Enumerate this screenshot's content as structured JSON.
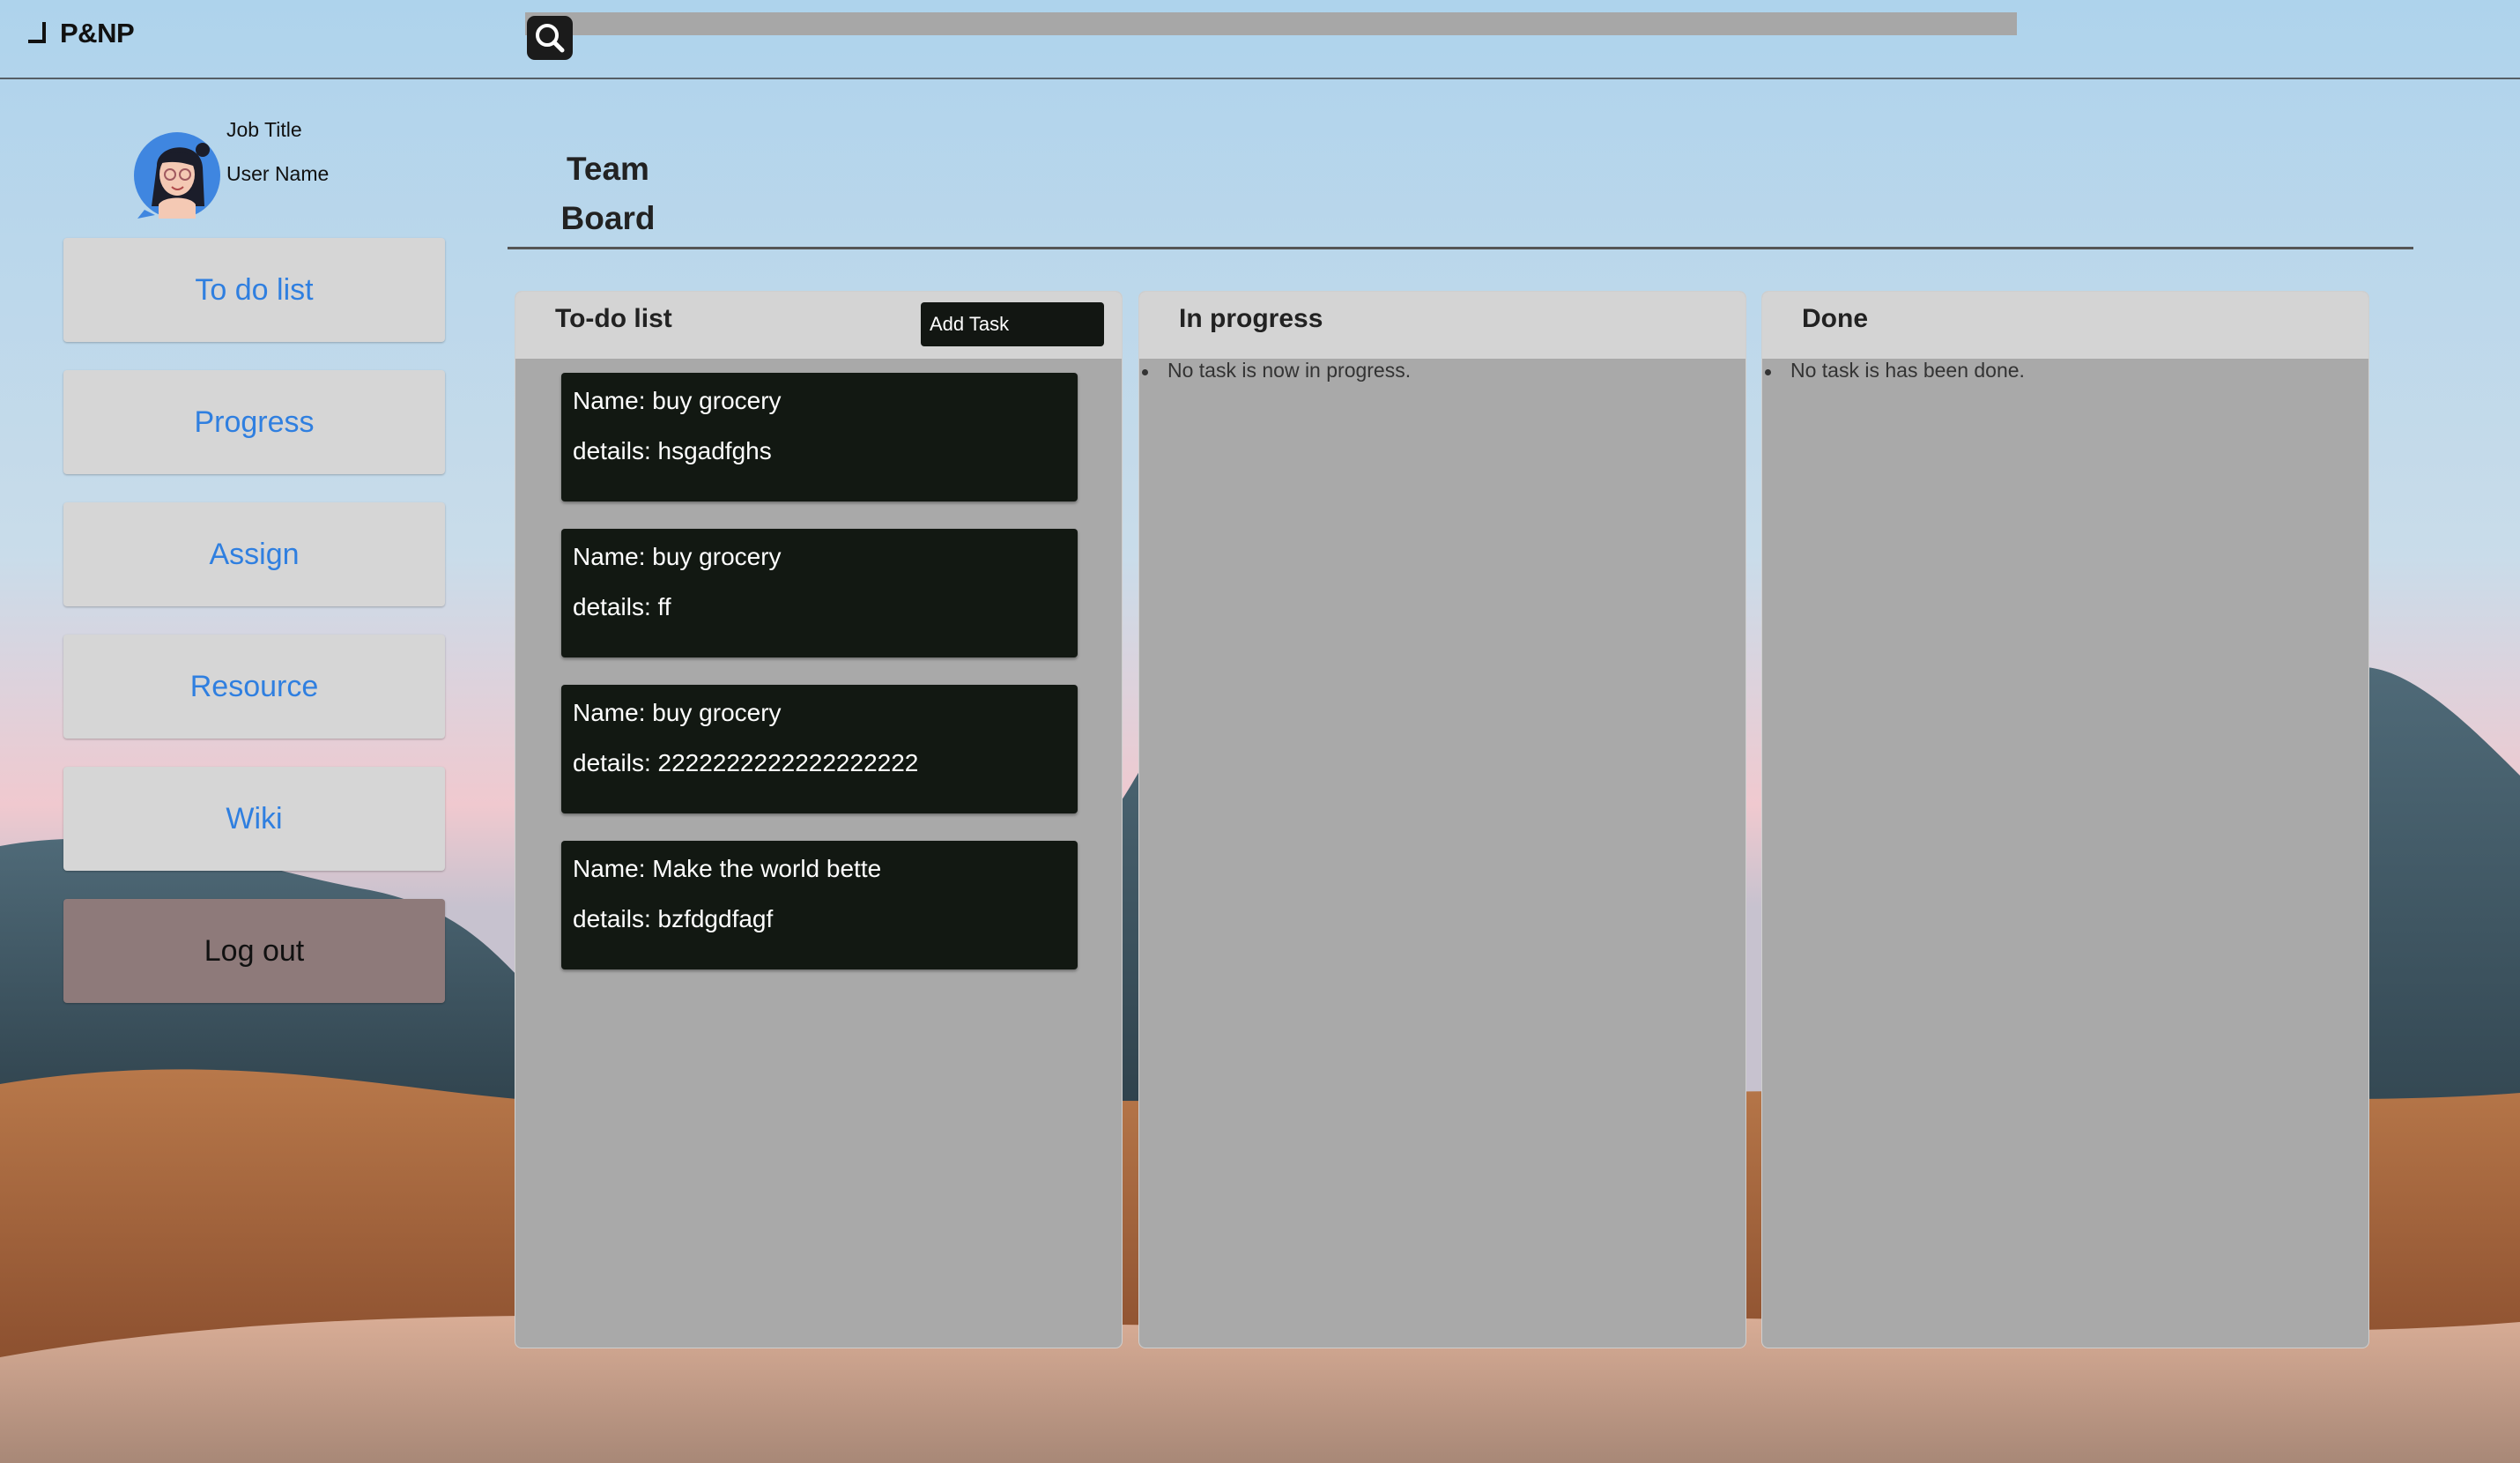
{
  "app": {
    "logo_text": "P&NP"
  },
  "search": {
    "button_icon": "search-icon"
  },
  "profile": {
    "job_title": "Job Title",
    "user_name": "User Name"
  },
  "sidebar": {
    "items": [
      {
        "label": "To do list"
      },
      {
        "label": "Progress"
      },
      {
        "label": "Assign"
      },
      {
        "label": "Resource"
      },
      {
        "label": "Wiki"
      }
    ],
    "logout_label": "Log out"
  },
  "board": {
    "title_line1": "Team",
    "title_line2": "Board",
    "columns": [
      {
        "title": "To-do list",
        "add_task_label": "Add Task",
        "tasks": [
          {
            "name": "Name: buy grocery",
            "details": "details: hsgadfghs"
          },
          {
            "name": "Name: buy grocery",
            "details": "details: ff"
          },
          {
            "name": "Name: buy grocery",
            "details": "details: 2222222222222222222"
          },
          {
            "name": "Name: Make the world bette",
            "details": "details: bzfdgdfagf"
          }
        ]
      },
      {
        "title": "In progress",
        "empty_message": "No task is now in progress."
      },
      {
        "title": "Done",
        "empty_message": "No task is has been done."
      }
    ]
  },
  "colors": {
    "nav_text": "#2f7fe0",
    "nav_bg": "#d6d6d6",
    "logout_bg": "#8e7a7a",
    "card_bg": "#121812",
    "column_bg": "#a9a9a9",
    "column_head_bg": "#d4d4d4"
  }
}
